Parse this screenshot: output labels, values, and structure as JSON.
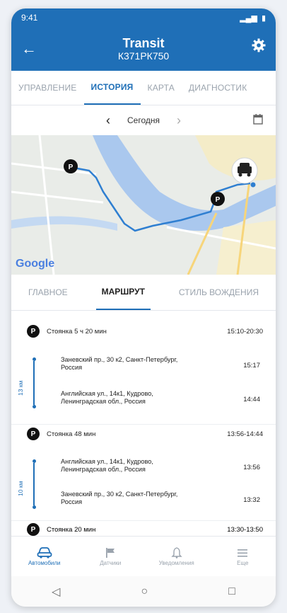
{
  "status": {
    "time": "9:41"
  },
  "header": {
    "title": "Transit",
    "plate": "К371РК750"
  },
  "tabs": [
    {
      "label": "УПРАВЛЕНИЕ"
    },
    {
      "label": "ИСТОРИЯ"
    },
    {
      "label": "КАРТА"
    },
    {
      "label": "ДИАГНОСТИК"
    }
  ],
  "date": {
    "label": "Сегодня"
  },
  "map": {
    "provider": "Google",
    "pin_label": "P"
  },
  "subtabs": [
    {
      "label": "ГЛАВНОЕ"
    },
    {
      "label": "МАРШРУТ"
    },
    {
      "label": "СТИЛЬ ВОЖДЕНИЯ"
    }
  ],
  "route": {
    "stops": [
      {
        "label": "Стоянка 5 ч 20 мин",
        "time": "15:10-20:30"
      },
      {
        "label": "Стоянка 48 мин",
        "time": "13:56-14:44"
      },
      {
        "label": "Стоянка 20 мин",
        "time": "13:30-13:50"
      }
    ],
    "trips": [
      {
        "distance": "13 км",
        "from_address": "Заневский пр., 30 к2, Санкт-Петербург, Россия",
        "from_time": "15:17",
        "to_address": "Английская ул., 14к1, Кудрово, Ленинградская обл., Россия",
        "to_time": "14:44"
      },
      {
        "distance": "10 км",
        "from_address": "Английская ул., 14к1, Кудрово, Ленинградская обл., Россия",
        "from_time": "13:56",
        "to_address": "Заневский пр., 30 к2, Санкт-Петербург, Россия",
        "to_time": "13:32"
      }
    ]
  },
  "bottom_nav": [
    {
      "label": "Автомобили",
      "icon": "car-icon"
    },
    {
      "label": "Датчики",
      "icon": "flag-icon"
    },
    {
      "label": "Уведомления",
      "icon": "bell-icon"
    },
    {
      "label": "Еще",
      "icon": "menu-icon"
    }
  ],
  "colors": {
    "primary": "#1f6fb7",
    "route": "#2f7fd1"
  }
}
